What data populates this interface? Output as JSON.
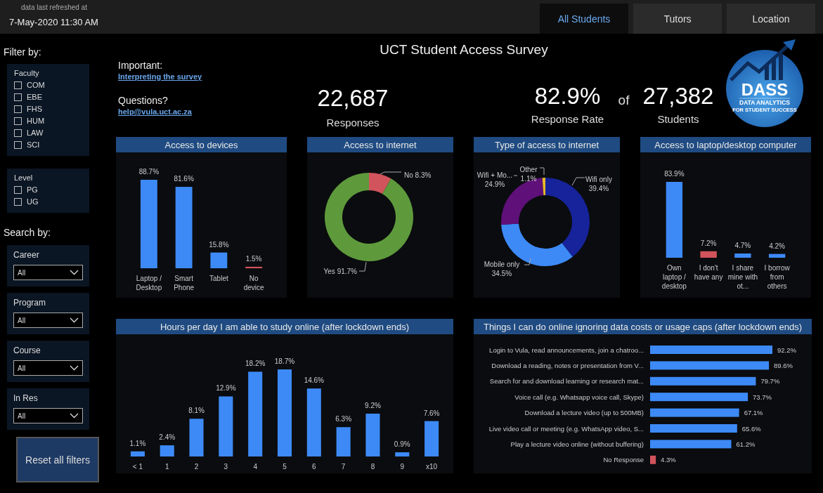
{
  "refresh": {
    "label": "data last refreshed at",
    "timestamp": "7-May-2020 11:30 AM"
  },
  "tabs": [
    {
      "label": "All Students",
      "selected": true
    },
    {
      "label": "Tutors",
      "selected": false
    },
    {
      "label": "Location",
      "selected": false
    }
  ],
  "sidebar": {
    "filter_heading": "Filter by:",
    "filters": [
      {
        "title": "Faculty",
        "options": [
          {
            "label": "COM",
            "checked": false
          },
          {
            "label": "EBE",
            "checked": false
          },
          {
            "label": "FHS",
            "checked": false
          },
          {
            "label": "HUM",
            "checked": false
          },
          {
            "label": "LAW",
            "checked": false
          },
          {
            "label": "SCI",
            "checked": false
          }
        ]
      },
      {
        "title": "Level",
        "options": [
          {
            "label": "PG",
            "checked": false
          },
          {
            "label": "UG",
            "checked": false
          }
        ]
      }
    ],
    "search_heading": "Search by:",
    "dropdowns": [
      {
        "label": "Career",
        "value": "All"
      },
      {
        "label": "Program",
        "value": "All"
      },
      {
        "label": "Course",
        "value": "All"
      },
      {
        "label": "In Res",
        "value": "All"
      }
    ],
    "reset_button": "Reset all filters"
  },
  "header": {
    "title": "UCT Student Access Survey",
    "notes": [
      {
        "heading": "Important:",
        "link": "Interpreting the survey"
      },
      {
        "heading": "Questions?",
        "link": "help@vula.uct.ac.za"
      }
    ],
    "responses": {
      "value": "22,687",
      "label": "Responses"
    },
    "response_rate": {
      "value": "82.9%",
      "label": "Response Rate"
    },
    "joiner": "of",
    "students": {
      "value": "27,382",
      "label": "Students"
    },
    "logo": {
      "name": "DASS",
      "line1": "DATA ANALYTICS",
      "line2": "FOR STUDENT SUCCESS"
    }
  },
  "panels": [
    {
      "title": "Access to devices",
      "chart_data": {
        "type": "bar",
        "orientation": "vertical",
        "categories": [
          "Laptop / Desktop",
          "Smart Phone",
          "Tablet",
          "No device"
        ],
        "data_labels": true,
        "series": [
          {
            "color": "#3d8af7",
            "values": [
              88.7,
              81.6,
              15.8,
              null
            ],
            "value_labels": [
              "88.7%",
              "81.6%",
              "15.8%",
              null
            ]
          },
          {
            "color": "#d1545c",
            "values": [
              null,
              null,
              null,
              1.5
            ],
            "value_labels": [
              null,
              null,
              null,
              "1.5%"
            ]
          }
        ]
      }
    },
    {
      "title": "Access to internet",
      "chart_data": {
        "type": "donut",
        "data_labels": true,
        "categories": [
          "No",
          "Yes"
        ],
        "values": [
          8.3,
          91.7
        ],
        "value_labels": [
          "8.3%",
          "91.7%"
        ]
      }
    },
    {
      "title": "Type of access to internet",
      "chart_data": {
        "type": "donut",
        "data_labels": true,
        "categories": [
          "Wifi only",
          "Mobile only",
          "Wifi + Mo...",
          "Other"
        ],
        "values": [
          39.4,
          34.5,
          24.9,
          1.1
        ],
        "value_labels": [
          "39.4%",
          "34.5%",
          "24.9%",
          "1.1%"
        ]
      }
    },
    {
      "title": "Access to laptop/desktop computer",
      "chart_data": {
        "type": "bar",
        "orientation": "vertical",
        "categories": [
          "Own laptop / desktop",
          "I don't have any",
          "I share mine with ot...",
          "I borrow from others"
        ],
        "data_labels": true,
        "series": [
          {
            "color": "#3d8af7",
            "values": [
              83.9,
              null,
              4.7,
              4.2
            ],
            "value_labels": [
              "83.9%",
              null,
              "4.7%",
              "4.2%"
            ]
          },
          {
            "color": "#d1545c",
            "values": [
              null,
              7.2,
              null,
              null
            ],
            "value_labels": [
              null,
              "7.2%",
              null,
              null
            ]
          }
        ]
      }
    },
    {
      "title": "Hours per day I am able to study online (after lockdown ends)",
      "chart_data": {
        "type": "bar",
        "orientation": "vertical",
        "categories": [
          "< 1",
          "1",
          "2",
          "3",
          "4",
          "5",
          "6",
          "7",
          "8",
          "9",
          "x10"
        ],
        "data_labels": true,
        "series": [
          {
            "color": "#3d8af7",
            "values": [
              1.1,
              2.4,
              8.1,
              12.9,
              18.2,
              18.7,
              14.6,
              6.3,
              9.2,
              0.9,
              7.6
            ],
            "value_labels": [
              "1.1%",
              "2.4%",
              "8.1%",
              "12.9%",
              "18.2%",
              "18.7%",
              "14.6%",
              "6.3%",
              "9.2%",
              "0.9%",
              "7.6%"
            ]
          }
        ]
      }
    },
    {
      "title": "Things I can do online ignoring data costs or usage caps (after lockdown ends)",
      "chart_data": {
        "type": "bar",
        "orientation": "horizontal",
        "categories": [
          "Login to Vula, read announcements, join a chatroo...",
          "Download a reading, notes or presentation from V...",
          "Search for and download learning or research mat...",
          "Voice call (e.g. Whatsapp voice call, Skype)",
          "Download a lecture video (up to 500MB)",
          "Live video call or meeting (e.g. WhatsApp video, S...",
          "Play a lecture video online (without buffering)",
          "No Response"
        ],
        "data_labels": true,
        "series": [
          {
            "color": "#3d8af7",
            "values": [
              92.2,
              89.6,
              79.7,
              73.7,
              67.1,
              65.6,
              61.2,
              null
            ],
            "value_labels": [
              "92.2%",
              "89.6%",
              "79.7%",
              "73.7%",
              "67.1%",
              "65.6%",
              "61.2%",
              null
            ]
          },
          {
            "color": "#d1545c",
            "values": [
              null,
              null,
              null,
              null,
              null,
              null,
              null,
              4.3
            ],
            "value_labels": [
              null,
              null,
              null,
              null,
              null,
              null,
              null,
              "4.3%"
            ]
          }
        ]
      }
    }
  ]
}
